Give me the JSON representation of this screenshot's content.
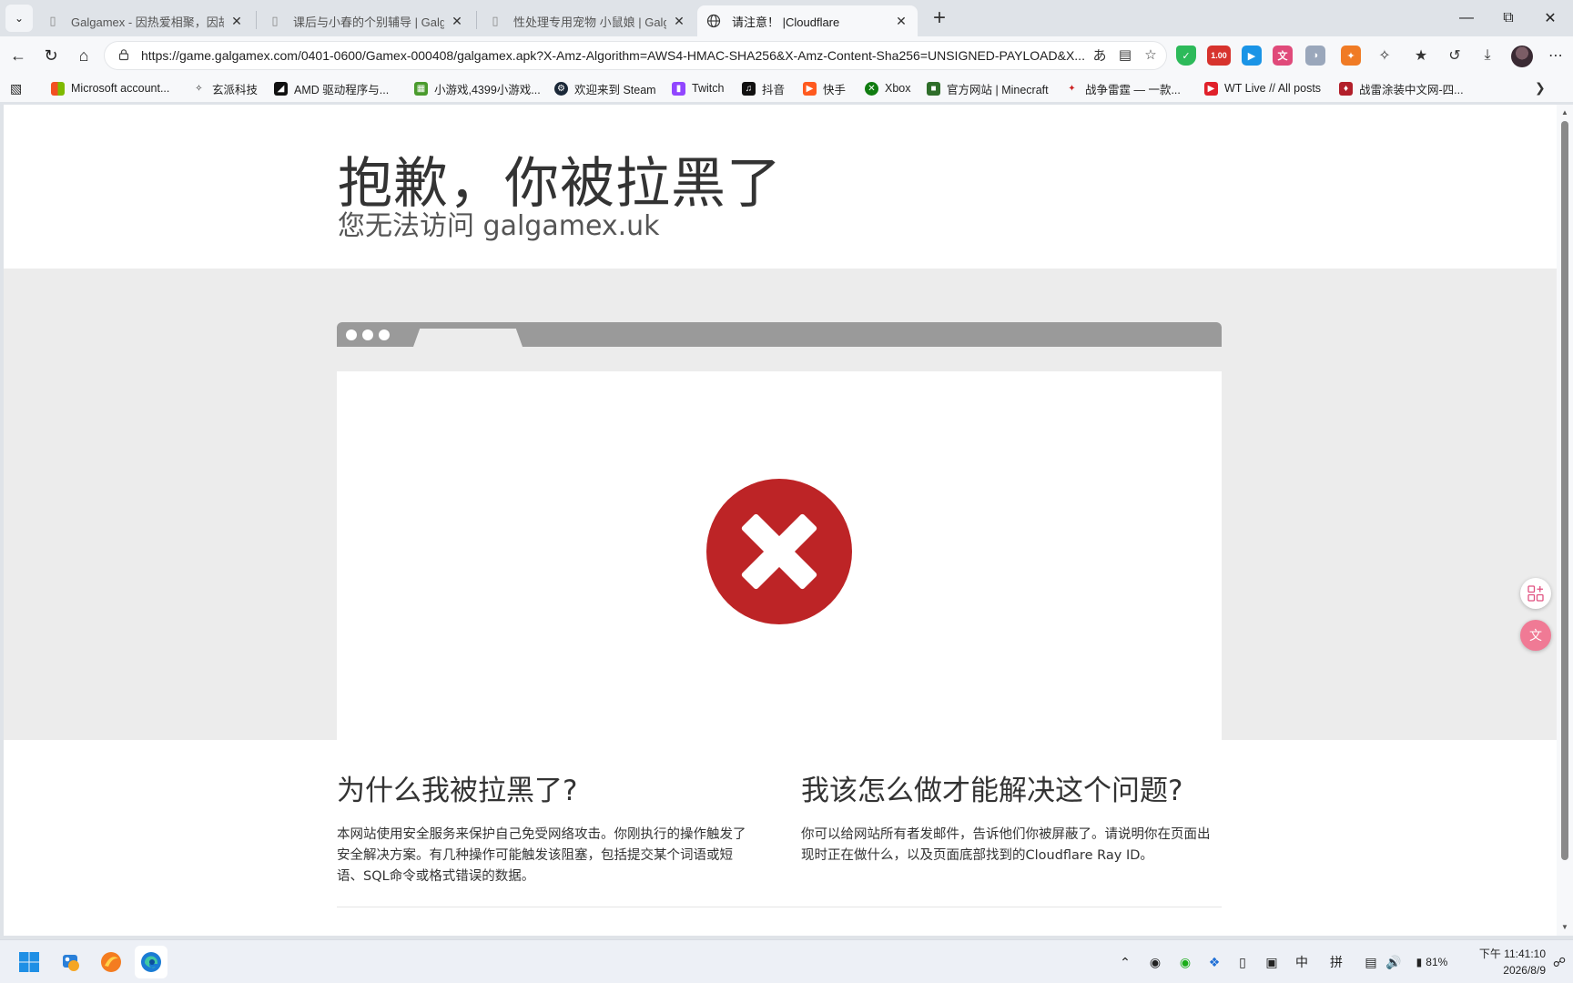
{
  "tabs": [
    {
      "title": "Galgamex - 因热爱相聚，因故事而",
      "active": false
    },
    {
      "title": "课后与小春的个别辅导 | Galgamex",
      "active": false
    },
    {
      "title": "性处理专用宠物 小鼠娘 | Galgame",
      "active": false
    },
    {
      "title": "请注意！ |Cloudflare",
      "active": true
    }
  ],
  "address": {
    "url": "https://game.galgamex.com/0401-0600/Gamex-000408/galgamex.apk?X-Amz-Algorithm=AWS4-HMAC-SHA256&X-Amz-Content-Sha256=UNSIGNED-PAYLOAD&X..."
  },
  "extensions": {
    "badge": "1.00"
  },
  "bookmarks": [
    {
      "label": "Microsoft account...",
      "icon": "microsoft-icon"
    },
    {
      "label": "玄派科技",
      "icon": "xuanpai-icon"
    },
    {
      "label": "AMD 驱动程序与...",
      "icon": "amd-icon"
    },
    {
      "label": "小游戏,4399小游戏...",
      "icon": "4399-icon"
    },
    {
      "label": "欢迎来到 Steam",
      "icon": "steam-icon"
    },
    {
      "label": "Twitch",
      "icon": "twitch-icon"
    },
    {
      "label": "抖音",
      "icon": "douyin-icon"
    },
    {
      "label": "快手",
      "icon": "kuaishou-icon"
    },
    {
      "label": "Xbox",
      "icon": "xbox-icon"
    },
    {
      "label": "官方网站 | Minecraft",
      "icon": "minecraft-icon"
    },
    {
      "label": "战争雷霆 — 一款...",
      "icon": "warthunder-icon"
    },
    {
      "label": "WT Live // All posts",
      "icon": "wtlive-icon"
    },
    {
      "label": "战雷涂装中文网-四...",
      "icon": "skins-icon"
    }
  ],
  "page": {
    "title": "抱歉，你被拉黑了",
    "subtitle": "您无法访问 galgamex.uk",
    "why_heading": "为什么我被拉黑了?",
    "why_text": "本网站使用安全服务来保护自己免受网络攻击。你刚执行的操作触发了安全解决方案。有几种操作可能触发该阻塞，包括提交某个词语或短语、SQL命令或格式错误的数据。",
    "fix_heading": "我该怎么做才能解决这个问题?",
    "fix_text": "你可以给网站所有者发邮件，告诉他们你被屏蔽了。请说明你在页面出现时正在做什么，以及页面底部找到的Cloudflare Ray ID。"
  },
  "taskbar": {
    "ime_lang": "中",
    "ime_mode": "拼",
    "battery": "81%",
    "time": "下午 11:41:10",
    "date": "2026/8/9"
  },
  "colors": {
    "error_red": "#bd2426",
    "browser_bar": "#9a9a9a",
    "grey_band": "#ececec"
  }
}
